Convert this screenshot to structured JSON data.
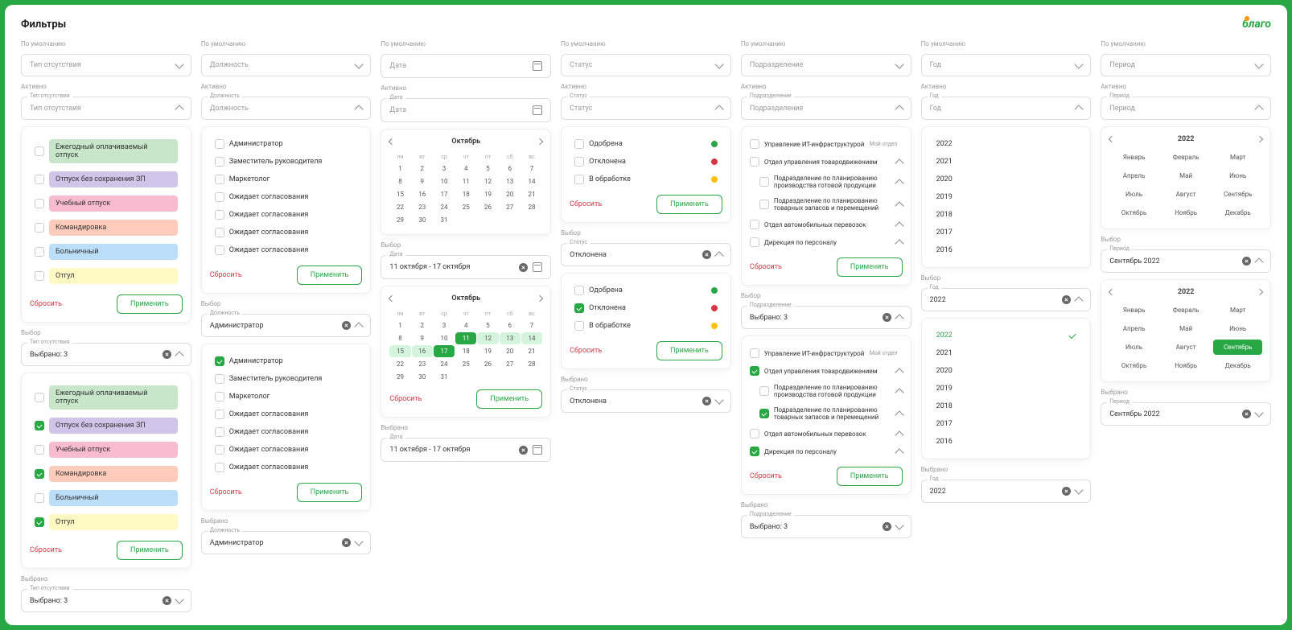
{
  "title": "Фильтры",
  "logo": "благо",
  "sect": {
    "def": "По умолчанию",
    "act": "Активно",
    "vyb": "Выбор",
    "vybr": "Выбрано"
  },
  "lbl": {
    "typ": "Тип отсутствия",
    "dol": "Должность",
    "dat": "Дата",
    "sta": "Статус",
    "pod": "Подразделение",
    "god": "Год",
    "per": "Период"
  },
  "val": {
    "typ": "Тип отсутствия",
    "dol": "Должность",
    "dat": "Дата",
    "sta": "Статус",
    "pod": "Подразделение",
    "god": "Год",
    "per": "Период",
    "vyb3": "Выбрано: 3",
    "adm": "Администратор",
    "drange": "11 октября - 17 октября",
    "otk": "Отклонена",
    "y2022": "2022",
    "sep22": "Сентябрь 2022"
  },
  "absTypes": [
    "Ежегодный оплачиваемый отпуск",
    "Отпуск без сохранения ЗП",
    "Учебный отпуск",
    "Командировка",
    "Больничный",
    "Отгул"
  ],
  "roles": [
    "Администратор",
    "Заместитель руководителя",
    "Маркетолог",
    "Ожидает согласования",
    "Ожидает согласования",
    "Ожидает согласования",
    "Ожидает согласования"
  ],
  "roles2": [
    "Администратор",
    "Заместитель руководителя",
    "Маркетолог",
    "Ожидает согласования",
    "Ожидает согласования",
    "Ожидает согласования",
    "Ожидает согласования"
  ],
  "cal": {
    "month": "Октябрь",
    "wd": [
      "пн",
      "вт",
      "ср",
      "чт",
      "пт",
      "сб",
      "вс"
    ],
    "rows": [
      [
        "1",
        "2",
        "3",
        "4",
        "5",
        "6",
        "7"
      ],
      [
        "8",
        "9",
        "10",
        "11",
        "12",
        "13",
        "14"
      ],
      [
        "15",
        "16",
        "17",
        "18",
        "19",
        "20",
        "21"
      ],
      [
        "22",
        "23",
        "24",
        "25",
        "26",
        "27",
        "28"
      ],
      [
        "29",
        "30",
        "31"
      ]
    ]
  },
  "status": [
    "Одобрена",
    "Отклонена",
    "В обработке"
  ],
  "depts": {
    "d0": "Управление ИТ-инфраструктурой",
    "tag": "Мой отдел",
    "d1": "Отдел управления товародвижением",
    "d2": "Подразделение по планированию производства готовой продукции",
    "d3": "Подразделение по планированию товарных запасов и перемещений",
    "d4": "Отдел автомобильных перевозок",
    "d5": "Дирекция по персоналу"
  },
  "years": [
    "2022",
    "2021",
    "2020",
    "2019",
    "2018",
    "2017",
    "2016"
  ],
  "periodYear": "2022",
  "months": [
    "Январь",
    "Февраль",
    "Март",
    "Апрель",
    "Май",
    "Июнь",
    "Июль",
    "Август",
    "Сентябрь",
    "Октябрь",
    "Ноябрь",
    "Декабрь"
  ],
  "btn": {
    "reset": "Сбросить",
    "apply": "Применить"
  }
}
